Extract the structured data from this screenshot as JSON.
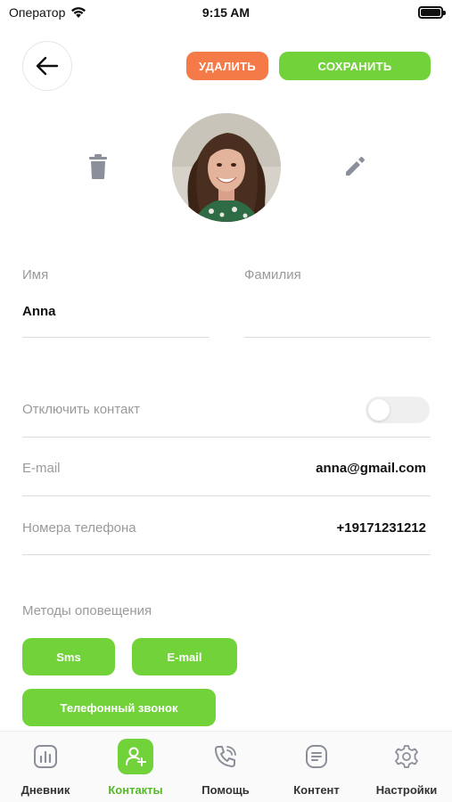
{
  "status_bar": {
    "carrier": "Оператор",
    "time": "9:15 AM"
  },
  "header": {
    "delete_label": "УДАЛИТЬ",
    "save_label": "СОХРАНИТЬ"
  },
  "colors": {
    "accent_green": "#72d23a",
    "delete_orange": "#f47a47",
    "active_tab_text": "#55b927"
  },
  "form": {
    "first_name_label": "Имя",
    "first_name_value": "Anna",
    "last_name_label": "Фамилия",
    "last_name_value": "",
    "disable_contact_label": "Отключить контакт",
    "disable_contact_on": false,
    "email_label": "E-mail",
    "email_value": "anna@gmail.com",
    "phone_label": "Номера телефона",
    "phone_value": "+19171231212",
    "notify_label": "Методы оповещения",
    "methods": [
      "Sms",
      "E-mail",
      "Телефонный звонок"
    ]
  },
  "tabs": [
    {
      "label": "Дневник",
      "icon": "chart-icon",
      "active": false
    },
    {
      "label": "Контакты",
      "icon": "add-user-icon",
      "active": true
    },
    {
      "label": "Помощь",
      "icon": "phone-icon",
      "active": false
    },
    {
      "label": "Контент",
      "icon": "document-icon",
      "active": false
    },
    {
      "label": "Настройки",
      "icon": "gear-icon",
      "active": false
    }
  ]
}
